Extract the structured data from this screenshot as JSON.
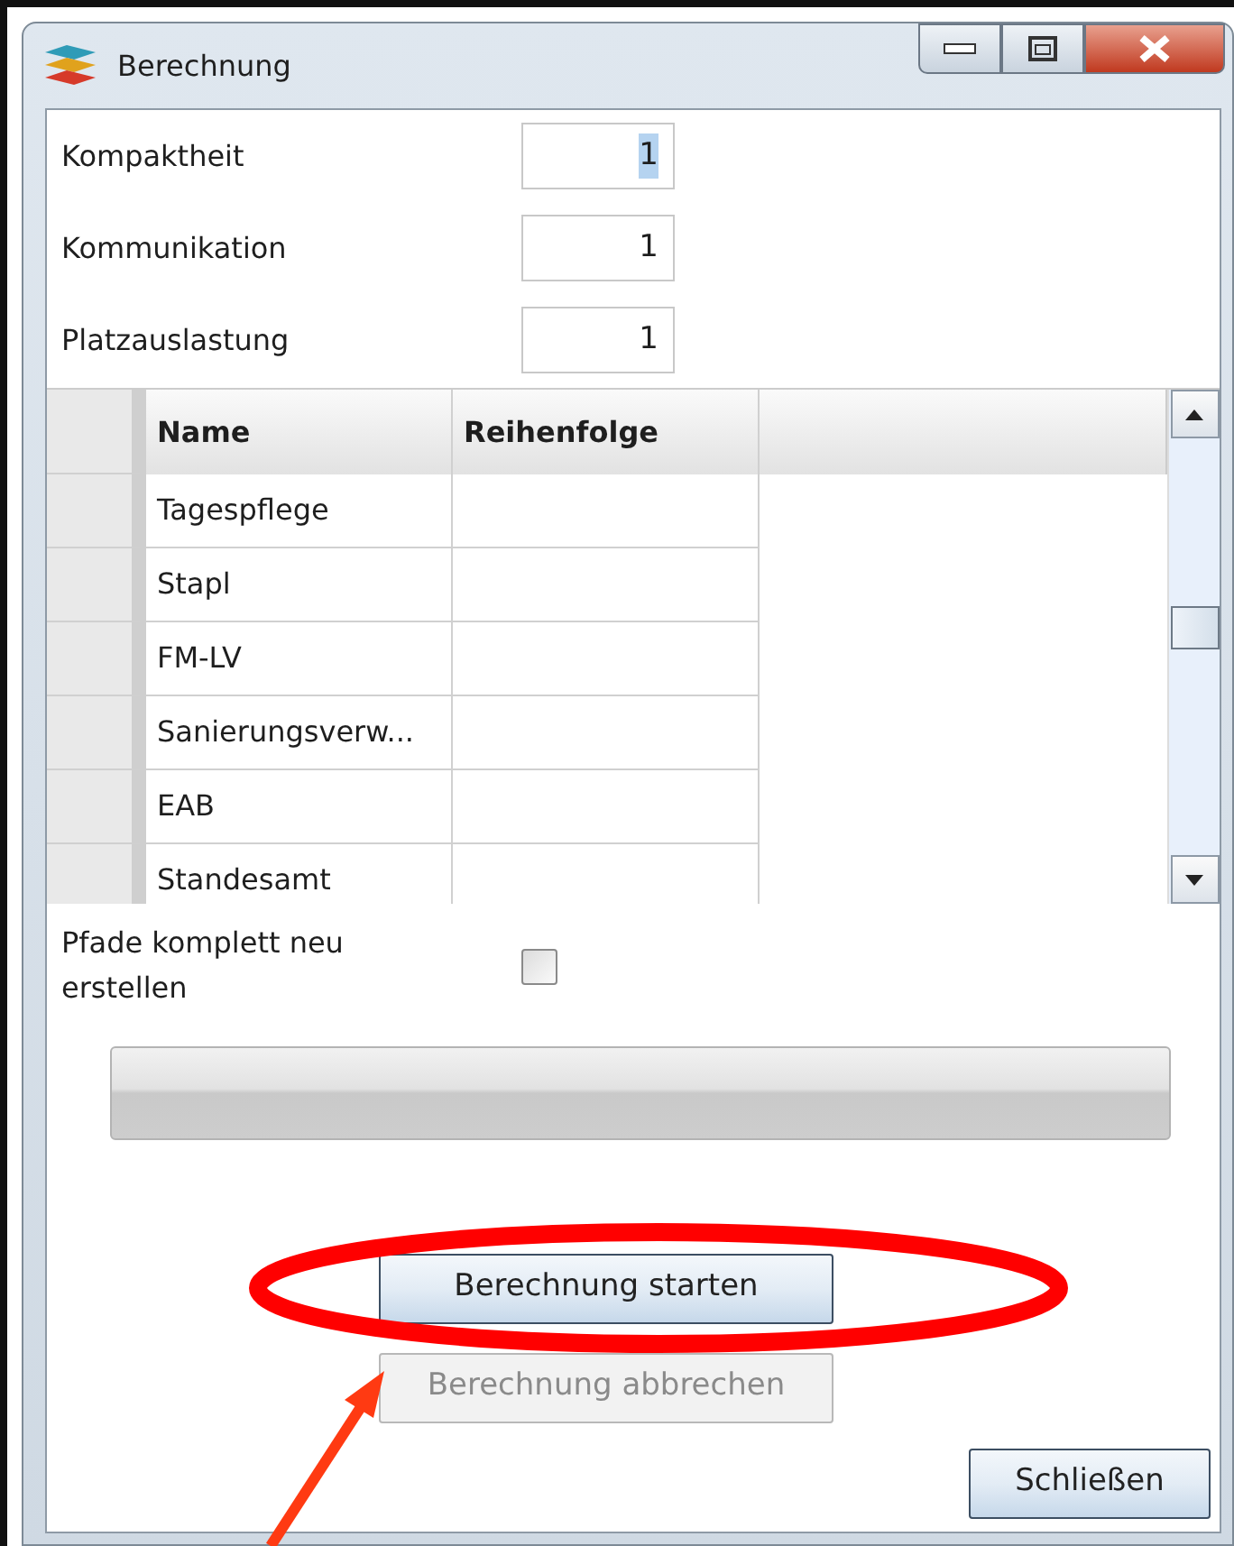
{
  "window": {
    "title": "Berechnung"
  },
  "fields": [
    {
      "label": "Kompaktheit",
      "value": "1",
      "text_selected": true
    },
    {
      "label": "Kommunikation",
      "value": "1",
      "text_selected": false
    },
    {
      "label": "Platzauslastung",
      "value": "1",
      "text_selected": false
    }
  ],
  "grid": {
    "columns": [
      "Name",
      "Reihenfolge"
    ],
    "rows": [
      {
        "name": "Tagespflege"
      },
      {
        "name": "Stapl"
      },
      {
        "name": "FM-LV"
      },
      {
        "name": "Sanierungsverw..."
      },
      {
        "name": "EAB"
      },
      {
        "name": "Standesamt"
      }
    ]
  },
  "options": [
    {
      "label": "Pfade komplett neu erstellen",
      "checked": false
    }
  ],
  "progress": {
    "level": 0
  },
  "buttons": [
    {
      "label": "Berechnung starten",
      "disabled": false
    },
    {
      "label": "Berechnung abbrechen",
      "disabled": true
    }
  ],
  "close_button": {
    "label": "Schließen"
  }
}
